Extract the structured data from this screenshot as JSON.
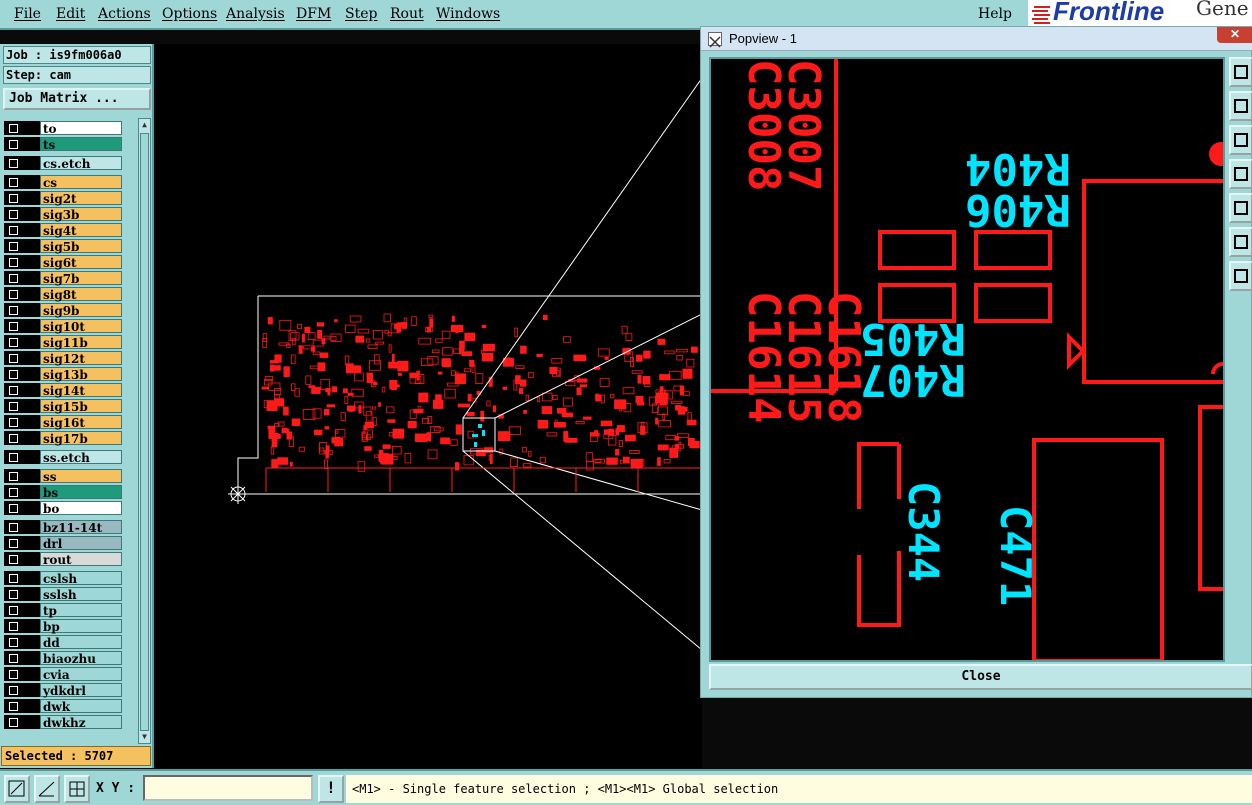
{
  "menubar": {
    "items": [
      "File",
      "Edit",
      "Actions",
      "Options",
      "Analysis",
      "DFM",
      "Step",
      "Rout",
      "Windows"
    ],
    "help": "Help",
    "logo": "Frontline",
    "logo_suffix": "Gene"
  },
  "job": {
    "job_label": "Job : is9fm006a0",
    "step_label": "Step: cam",
    "matrix_button": "Job Matrix ..."
  },
  "layers": [
    {
      "name": "to",
      "color": "#ffffff"
    },
    {
      "name": "ts",
      "color": "#1f9a7a"
    },
    {
      "name": "cs.etch",
      "color": "#bfe6e6"
    },
    {
      "name": "cs",
      "color": "#f5c060"
    },
    {
      "name": "sig2t",
      "color": "#f5c060"
    },
    {
      "name": "sig3b",
      "color": "#f5c060"
    },
    {
      "name": "sig4t",
      "color": "#f5c060"
    },
    {
      "name": "sig5b",
      "color": "#f5c060"
    },
    {
      "name": "sig6t",
      "color": "#f5c060"
    },
    {
      "name": "sig7b",
      "color": "#f5c060"
    },
    {
      "name": "sig8t",
      "color": "#f5c060"
    },
    {
      "name": "sig9b",
      "color": "#f5c060"
    },
    {
      "name": "sig10t",
      "color": "#f5c060"
    },
    {
      "name": "sig11b",
      "color": "#f5c060"
    },
    {
      "name": "sig12t",
      "color": "#f5c060"
    },
    {
      "name": "sig13b",
      "color": "#f5c060"
    },
    {
      "name": "sig14t",
      "color": "#f5c060"
    },
    {
      "name": "sig15b",
      "color": "#f5c060"
    },
    {
      "name": "sig16t",
      "color": "#f5c060"
    },
    {
      "name": "sig17b",
      "color": "#f5c060"
    },
    {
      "name": "ss.etch",
      "color": "#bfe6e6"
    },
    {
      "name": "ss",
      "color": "#f5c060"
    },
    {
      "name": "bs",
      "color": "#1f9a7a"
    },
    {
      "name": "bo",
      "color": "#ffffff"
    },
    {
      "name": "bz11-14t",
      "color": "#9ab8c0"
    },
    {
      "name": "drl",
      "color": "#9ab8c0"
    },
    {
      "name": "rout",
      "color": "#d9d9d9"
    },
    {
      "name": "cslsh",
      "color": "#9fd6d6"
    },
    {
      "name": "sslsh",
      "color": "#9fd6d6"
    },
    {
      "name": "tp",
      "color": "#9fd6d6"
    },
    {
      "name": "bp",
      "color": "#9fd6d6"
    },
    {
      "name": "dd",
      "color": "#9fd6d6"
    },
    {
      "name": "biaozhu",
      "color": "#9fd6d6"
    },
    {
      "name": "cvia",
      "color": "#9fd6d6"
    },
    {
      "name": "ydkdrl",
      "color": "#9fd6d6"
    },
    {
      "name": "dwk",
      "color": "#9fd6d6"
    },
    {
      "name": "dwkhz",
      "color": "#9fd6d6"
    }
  ],
  "selected": "Selected : 5707",
  "popview": {
    "title": "Popview - 1",
    "close_button": "Close",
    "labels": [
      "R404",
      "R406",
      "R405",
      "R407",
      "C344",
      "C471"
    ],
    "rotated_labels": [
      "C1615",
      "C1614",
      "C3007",
      "C3008",
      "C1618"
    ]
  },
  "statusbar": {
    "xy_label": "X Y :",
    "xy_value": "",
    "bang": "!",
    "hint": "<M1> - Single feature selection ; <M1><M1> Global selection"
  },
  "colors": {
    "panel": "#9fd6d6",
    "feature_red": "#ff0000",
    "feature_cyan": "#00e5ff",
    "profile_white": "#ffffff"
  }
}
